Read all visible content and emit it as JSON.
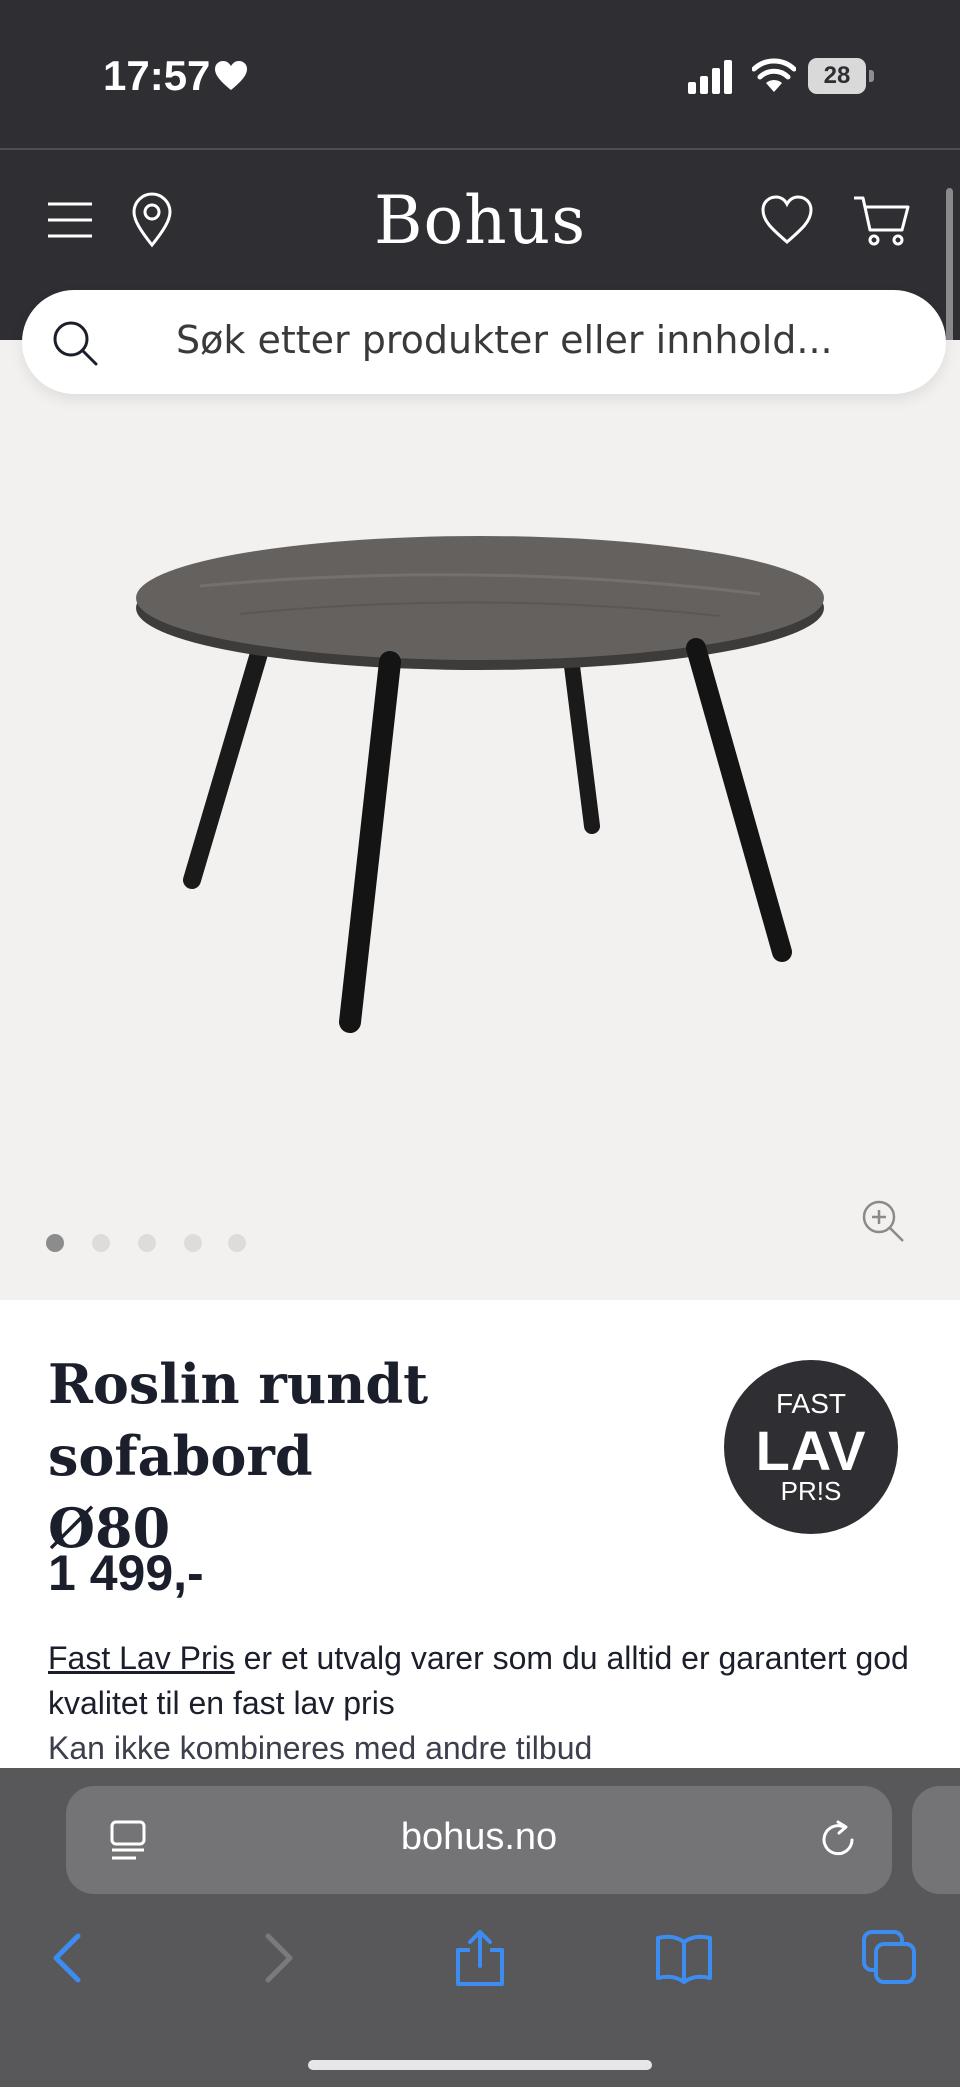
{
  "status_bar": {
    "time": "17:57",
    "battery": "28"
  },
  "header": {
    "brand": "Bohus",
    "icons": [
      "menu-icon",
      "location-icon",
      "heart-icon",
      "cart-icon"
    ]
  },
  "search": {
    "placeholder": "Søk etter produkter eller innhold..."
  },
  "gallery": {
    "image_count": 5,
    "active_index": 0
  },
  "product": {
    "title_line1": "Roslin rundt sofabord",
    "title_line2": "Ø80",
    "price": "1 499,-",
    "badge": {
      "top": "FAST",
      "mid": "LAV",
      "bot": "PR!S"
    },
    "info_link": "Fast Lav Pris",
    "info_text": " er et utvalg varer som du alltid er garantert god kvalitet til en fast lav pris",
    "note": "Kan ikke kombineres med andre tilbud"
  },
  "browser": {
    "url": "bohus.no"
  },
  "colors": {
    "header_bg": "#2f2f33",
    "gallery_bg": "#f3f1ef",
    "toolbar_blue": "#3d8cf0"
  }
}
